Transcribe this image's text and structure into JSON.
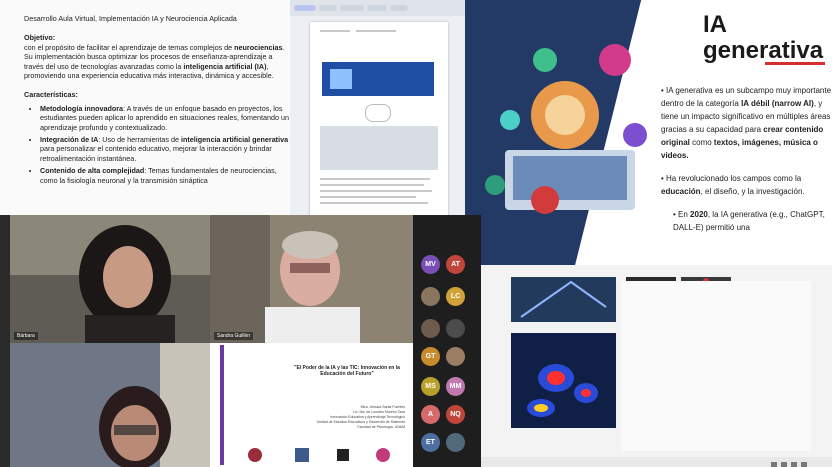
{
  "document": {
    "title": "Desarrollo Aula Virtual, Implementación IA y Neurociencia Aplicada",
    "objective_heading": "Objetivo:",
    "objective_text_1": "con el propósito de facilitar el aprendizaje de temas complejos de ",
    "objective_bold_1": "neurociencias",
    "objective_text_2": ". Su implementación busca optimizar los procesos de enseñanza-aprendizaje a través del uso de tecnologías avanzadas como la ",
    "objective_bold_2": "inteligencia artificial (IA)",
    "objective_text_3": ", promoviendo una experiencia educativa más interactiva, dinámica y accesible.",
    "features_heading": "Características:",
    "features": [
      {
        "bold": "Metodología innovadora",
        "text": ": A través de un enfoque basado en proyectos, los estudiantes pueden aplicar lo aprendido en situaciones reales, fomentando un aprendizaje profundo y contextualizado."
      },
      {
        "bold": "Integración de IA",
        "text": ": Uso de herramientas de ",
        "bold2": "inteligencia artificial generativa",
        "text2": " para personalizar el contenido educativo, mejorar la interacción y brindar retroalimentación instantánea."
      },
      {
        "bold": "Contenido de alta complejidad",
        "text": ": Temas fundamentales de neurociencias, como la fisiología neuronal y la transmisión sináptica"
      }
    ]
  },
  "slide": {
    "title_line1": "IA",
    "title_line2": "generativa",
    "p1_a": "IA generativa es un subcampo muy importante dentro de la categoría ",
    "p1_bold": "IA débil (narrow AI)",
    "p1_b": ", y tiene un impacto significativo en múltiples áreas gracias a su capacidad para ",
    "p1_bold2": "crear contenido original",
    "p1_c": " como ",
    "p1_bold3": "textos, imágenes, música o videos.",
    "p2_a": "Ha revolucionado los campos como la ",
    "p2_bold": "educación",
    "p2_b": ", el diseño, y la investigación.",
    "p3_a": "En ",
    "p3_bold": "2020",
    "p3_b": ", la IA generativa (e.g., ChatGPT, DALL-E) permitió una",
    "accent": "#d3302f"
  },
  "shared_slide": {
    "title": "\"El Poder de la IA y las TIC: Innovación en la Educación del Futuro\"",
    "authors": [
      "Mtra. Jessica Santa Fuentes",
      "Lic. Ma. de Lourdes Moreno Taza",
      "Innovación Educativa y Aprendizaje Tecnológico",
      "Unidad de Estudios Educativos y Desarrollo de Sistemas",
      "Facultad de Psicología, UNAM"
    ]
  },
  "participants": [
    {
      "initials": "MV",
      "color": "#7a4fb5"
    },
    {
      "initials": "AT",
      "color": "#c0463c"
    },
    {
      "initials": "",
      "color": "#8a7660"
    },
    {
      "initials": "LC",
      "color": "#d2a23a"
    },
    {
      "initials": "",
      "color": "#6d5b4d"
    },
    {
      "initials": "",
      "color": "#4c4c4c"
    },
    {
      "initials": "GT",
      "color": "#c88a2f"
    },
    {
      "initials": "",
      "color": "#9a7f64"
    },
    {
      "initials": "MS",
      "color": "#b9a02a"
    },
    {
      "initials": "MM",
      "color": "#c07ab0"
    },
    {
      "initials": "A",
      "color": "#d46a6a"
    },
    {
      "initials": "NQ",
      "color": "#c0463c"
    },
    {
      "initials": "ET",
      "color": "#4d6fa0"
    },
    {
      "initials": "",
      "color": "#506a7a"
    }
  ],
  "videos": [
    {
      "name": "Bárbara"
    },
    {
      "name": "Sandra Guillén"
    },
    {
      "name": ""
    }
  ]
}
